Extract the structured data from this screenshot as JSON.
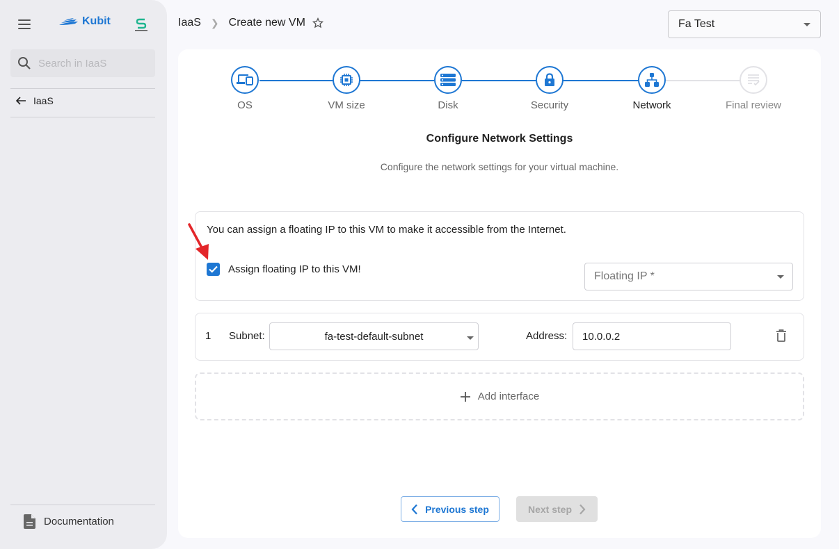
{
  "sidebar": {
    "brand": "Kubit",
    "search_placeholder": "Search in IaaS",
    "back_label": "IaaS",
    "documentation_label": "Documentation"
  },
  "header": {
    "breadcrumb": [
      "IaaS",
      "Create new VM"
    ],
    "project_selected": "Fa Test"
  },
  "stepper": {
    "steps": [
      {
        "label": "OS",
        "icon": "devices-icon",
        "state": "done"
      },
      {
        "label": "VM size",
        "icon": "chip-icon",
        "state": "done"
      },
      {
        "label": "Disk",
        "icon": "storage-icon",
        "state": "done"
      },
      {
        "label": "Security",
        "icon": "lock-icon",
        "state": "done"
      },
      {
        "label": "Network",
        "icon": "network-icon",
        "state": "active"
      },
      {
        "label": "Final review",
        "icon": "review-icon",
        "state": "disabled"
      }
    ]
  },
  "content": {
    "title": "Configure Network Settings",
    "subtitle": "Configure the network settings for your virtual machine.",
    "floating_ip": {
      "info": "You can assign a floating IP to this VM to make it accessible from the Internet.",
      "checkbox_label": "Assign floating IP to this VM!",
      "checked": true,
      "select_placeholder": "Floating IP *"
    },
    "interfaces": [
      {
        "index": "1",
        "subnet_label": "Subnet:",
        "subnet": "fa-test-default-subnet",
        "address_label": "Address:",
        "address": "10.0.0.2"
      }
    ],
    "add_interface_label": "Add interface"
  },
  "footer": {
    "previous_label": "Previous step",
    "next_label": "Next step"
  },
  "colors": {
    "accent": "#1e77d3",
    "annotation_arrow": "#e3262a"
  }
}
